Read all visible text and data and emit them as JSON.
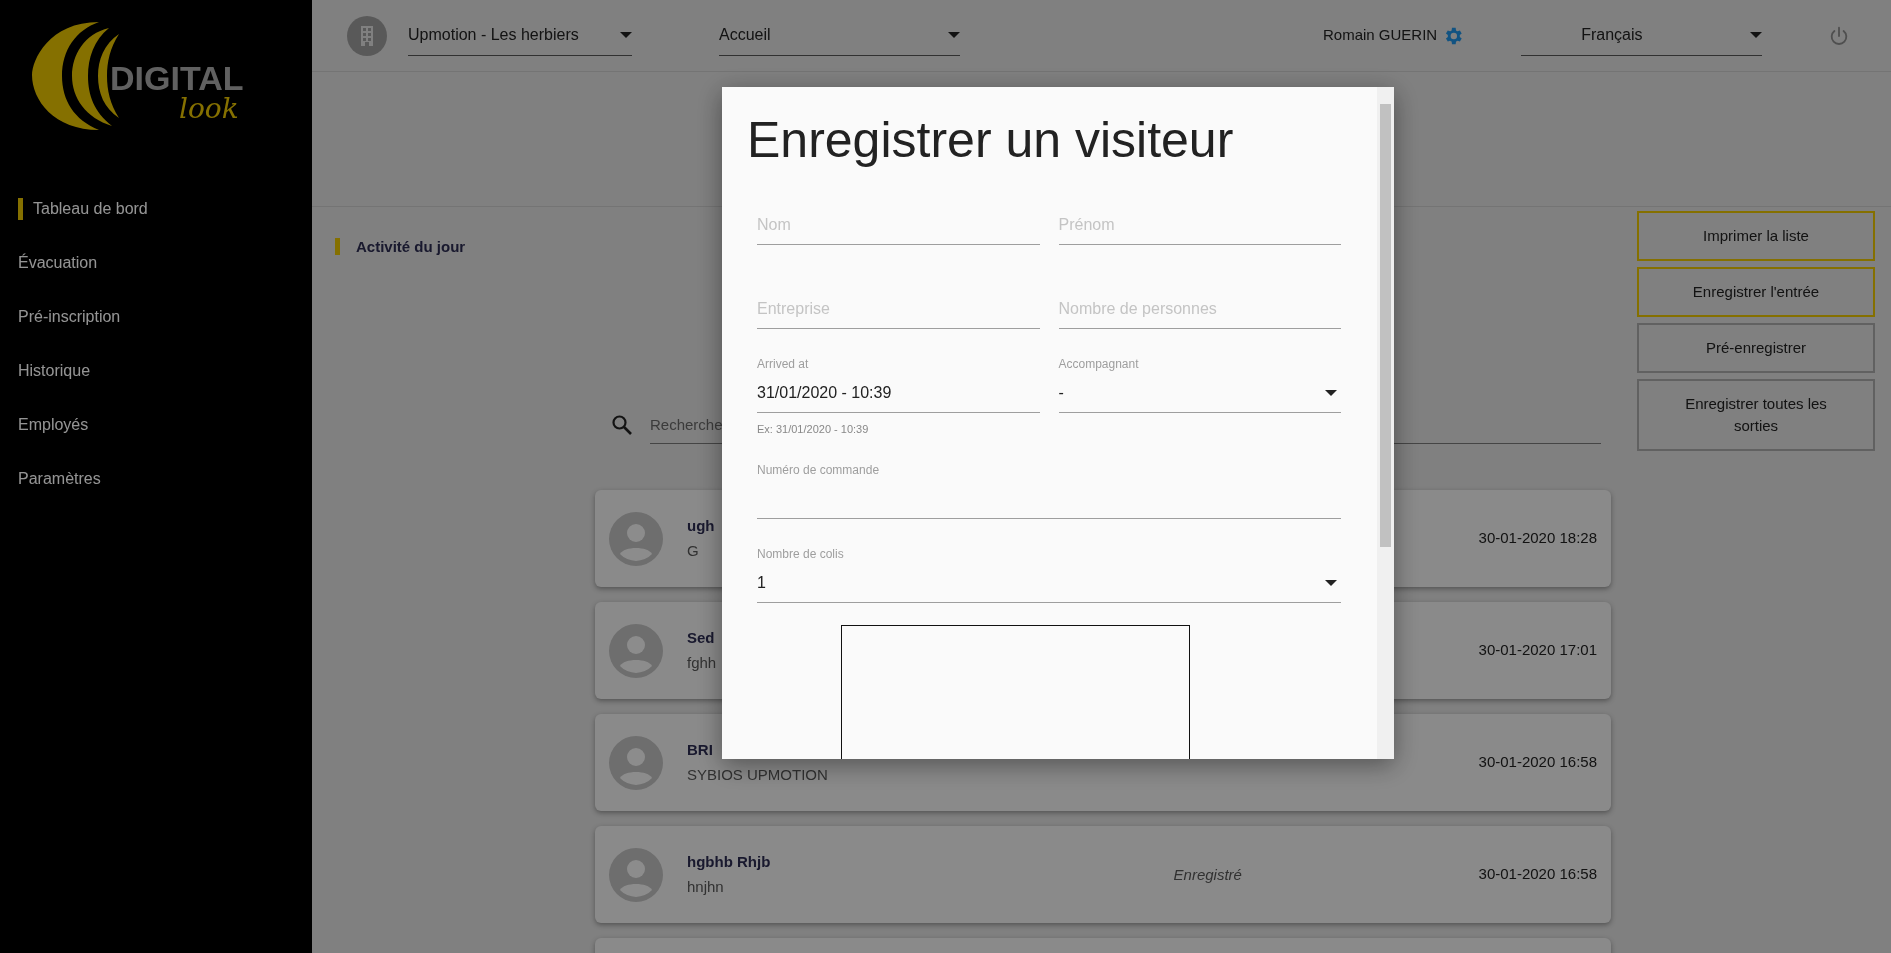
{
  "sidebar": {
    "logo": {
      "word": "DIGITAL",
      "script": "look"
    },
    "items": [
      {
        "label": "Tableau de bord",
        "selected": true
      },
      {
        "label": "Évacuation",
        "selected": false
      },
      {
        "label": "Pré-inscription",
        "selected": false
      },
      {
        "label": "Historique",
        "selected": false
      },
      {
        "label": "Employés",
        "selected": false
      },
      {
        "label": "Paramètres",
        "selected": false
      }
    ]
  },
  "topbar": {
    "site_select": {
      "value": "Upmotion - Les herbiers"
    },
    "page_select": {
      "value": "Accueil"
    },
    "user": "Romain GUERIN",
    "language_select": {
      "value": "Français"
    }
  },
  "section_title": "Activité du jour",
  "actions": [
    {
      "label": "Imprimer la liste",
      "emphasized": true
    },
    {
      "label": "Enregistrer l'entrée",
      "emphasized": true
    },
    {
      "label": "Pré-enregistrer",
      "emphasized": false
    },
    {
      "label": "Enregistrer toutes les sorties",
      "emphasized": false
    }
  ],
  "search": {
    "placeholder": "Recherche"
  },
  "visits": [
    {
      "name": "ugh",
      "company": "G",
      "date": "30-01-2020 18:28"
    },
    {
      "name": "Sed",
      "company": "fghh",
      "date": "30-01-2020 17:01"
    },
    {
      "name": "BRI",
      "company": "SYBIOS UPMOTION",
      "date": "30-01-2020 16:58"
    },
    {
      "name": "hgbhb Rhjb",
      "company": "hnjhn",
      "status": "Enregistré",
      "date": "30-01-2020 16:58"
    }
  ],
  "modal": {
    "title": "Enregistrer un visiteur",
    "rows": [
      [
        {
          "kind": "text",
          "placeholder": "Nom"
        },
        {
          "kind": "text",
          "placeholder": "Prénom"
        }
      ],
      [
        {
          "kind": "text",
          "placeholder": "Entreprise"
        },
        {
          "kind": "text",
          "placeholder": "Nombre de personnes"
        }
      ],
      [
        {
          "kind": "text",
          "label": "Arrived at",
          "value": "31/01/2020 - 10:39",
          "hint": "Ex: 31/01/2020 - 10:39"
        },
        {
          "kind": "select",
          "label": "Accompagnant",
          "value": "-"
        }
      ],
      [
        {
          "kind": "text",
          "label": "Numéro de commande"
        }
      ],
      [
        {
          "kind": "select",
          "label": "Nombre de colis",
          "value": "1"
        }
      ]
    ]
  }
}
